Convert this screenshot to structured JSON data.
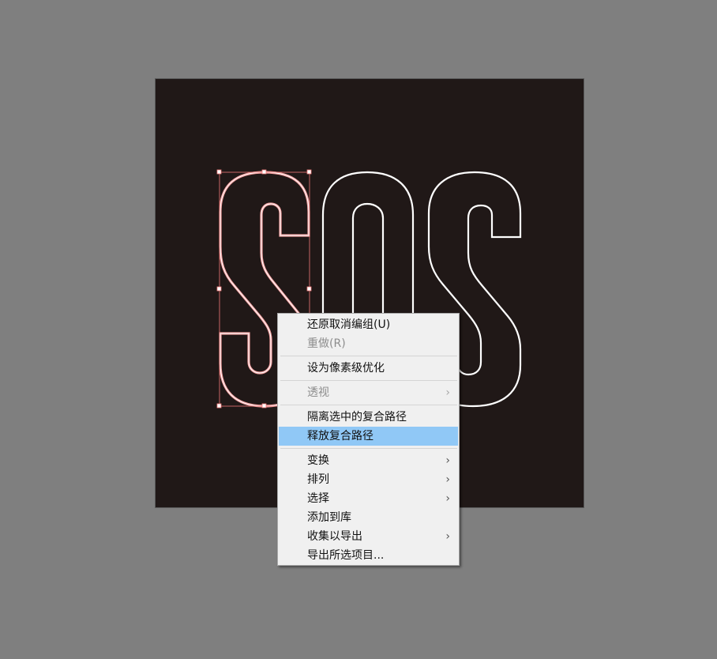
{
  "canvas": {
    "background": "#7f7f7f",
    "artboard_color": "#201817",
    "artwork_text": "SOS",
    "selection_color": "#f07a7a"
  },
  "context_menu": {
    "groups": [
      [
        {
          "label": "还原取消编组(U)",
          "enabled": true
        },
        {
          "label": "重做(R)",
          "enabled": false
        }
      ],
      [
        {
          "label": "设为像素级优化",
          "enabled": true
        }
      ],
      [
        {
          "label": "透视",
          "enabled": false,
          "submenu": true
        }
      ],
      [
        {
          "label": "隔离选中的复合路径",
          "enabled": true
        },
        {
          "label": "释放复合路径",
          "enabled": true,
          "highlighted": true
        }
      ],
      [
        {
          "label": "变换",
          "enabled": true,
          "submenu": true
        },
        {
          "label": "排列",
          "enabled": true,
          "submenu": true
        },
        {
          "label": "选择",
          "enabled": true,
          "submenu": true
        },
        {
          "label": "添加到库",
          "enabled": true
        },
        {
          "label": "收集以导出",
          "enabled": true,
          "submenu": true
        },
        {
          "label": "导出所选项目...",
          "enabled": true
        }
      ]
    ],
    "submenu_arrow": "›",
    "highlight_color": "#90c8f6"
  }
}
